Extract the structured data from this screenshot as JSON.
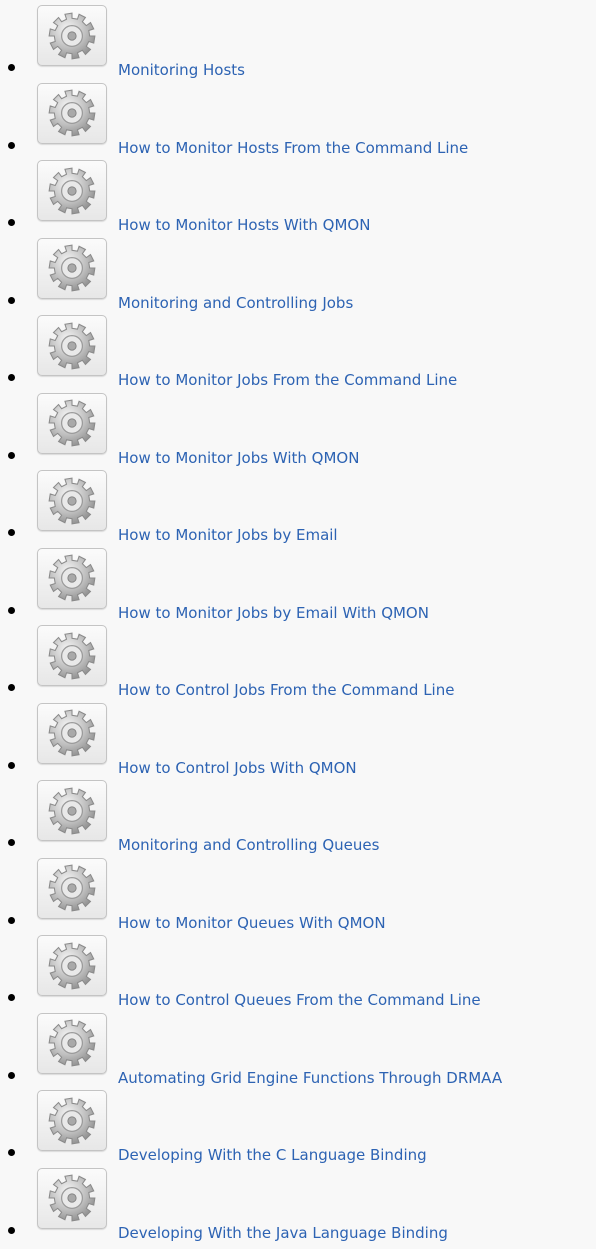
{
  "icon": "gear-icon",
  "colors": {
    "link": "#2d63b3",
    "background": "#f8f8f8"
  },
  "items": [
    {
      "label": "Monitoring Hosts"
    },
    {
      "label": "How to Monitor Hosts From the Command Line"
    },
    {
      "label": "How to Monitor Hosts With QMON"
    },
    {
      "label": "Monitoring and Controlling Jobs"
    },
    {
      "label": "How to Monitor Jobs From the Command Line"
    },
    {
      "label": "How to Monitor Jobs With QMON"
    },
    {
      "label": "How to Monitor Jobs by Email"
    },
    {
      "label": "How to Monitor Jobs by Email With QMON"
    },
    {
      "label": "How to Control Jobs From the Command Line"
    },
    {
      "label": "How to Control Jobs With QMON"
    },
    {
      "label": "Monitoring and Controlling Queues"
    },
    {
      "label": "How to Monitor Queues With QMON"
    },
    {
      "label": "How to Control Queues From the Command Line"
    },
    {
      "label": "Automating Grid Engine Functions Through DRMAA"
    },
    {
      "label": "Developing With the C Language Binding"
    },
    {
      "label": "Developing With the Java Language Binding"
    }
  ]
}
